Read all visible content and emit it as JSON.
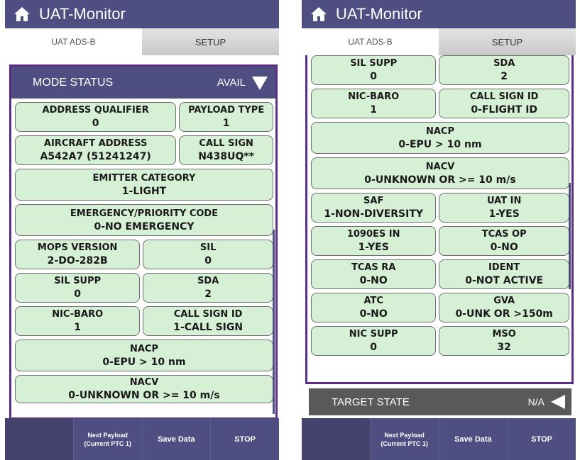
{
  "colors": {
    "appbar": "#4e4e83",
    "panel_border": "#5b2d87",
    "cell_bg": "#d6f0d6",
    "target_bar": "#595959"
  },
  "left": {
    "app_title": "UAT-Monitor",
    "tabs": [
      {
        "label": "UAT ADS-B"
      },
      {
        "label": "SETUP"
      }
    ],
    "section": {
      "label": "MODE STATUS",
      "status": "AVAIL"
    },
    "rows": [
      [
        {
          "k": "ADDRESS QUALIFIER",
          "v": "0"
        },
        {
          "k": "PAYLOAD TYPE",
          "v": "1"
        }
      ],
      [
        {
          "k": "AIRCRAFT ADDRESS",
          "v": "A542A7 (51241247)"
        },
        {
          "k": "CALL SIGN",
          "v": "N438UQ**"
        }
      ],
      [
        {
          "k": "EMITTER CATEGORY",
          "v": "1-LIGHT"
        }
      ],
      [
        {
          "k": "EMERGENCY/PRIORITY CODE",
          "v": "0-NO EMERGENCY"
        }
      ],
      [
        {
          "k": "MOPS VERSION",
          "v": "2-DO-282B"
        },
        {
          "k": "SIL",
          "v": "0"
        }
      ],
      [
        {
          "k": "SIL SUPP",
          "v": "0"
        },
        {
          "k": "SDA",
          "v": "2"
        }
      ],
      [
        {
          "k": "NIC-BARO",
          "v": "1"
        },
        {
          "k": "CALL SIGN ID",
          "v": "1-CALL SIGN"
        }
      ],
      [
        {
          "k": "NACP",
          "v": "0-EPU > 10 nm"
        }
      ],
      [
        {
          "k": "NACV",
          "v": "0-UNKNOWN OR >= 10 m/s"
        }
      ]
    ],
    "bottom": {
      "next_payload": "Next Payload",
      "next_payload_sub": "(Current PTC 1)",
      "save": "Save Data",
      "stop": "STOP"
    }
  },
  "right": {
    "app_title": "UAT-Monitor",
    "tabs": [
      {
        "label": "UAT ADS-B"
      },
      {
        "label": "SETUP"
      }
    ],
    "rows": [
      [
        {
          "k": "SIL SUPP",
          "v": "0"
        },
        {
          "k": "SDA",
          "v": "2"
        }
      ],
      [
        {
          "k": "NIC-BARO",
          "v": "1"
        },
        {
          "k": "CALL SIGN ID",
          "v": "0-FLIGHT ID"
        }
      ],
      [
        {
          "k": "NACP",
          "v": "0-EPU > 10 nm"
        }
      ],
      [
        {
          "k": "NACV",
          "v": "0-UNKNOWN OR >= 10 m/s"
        }
      ],
      [
        {
          "k": "SAF",
          "v": "1-NON-DIVERSITY"
        },
        {
          "k": "UAT IN",
          "v": "1-YES"
        }
      ],
      [
        {
          "k": "1090ES IN",
          "v": "1-YES"
        },
        {
          "k": "TCAS OP",
          "v": "0-NO"
        }
      ],
      [
        {
          "k": "TCAS RA",
          "v": "0-NO"
        },
        {
          "k": "IDENT",
          "v": "0-NOT ACTIVE"
        }
      ],
      [
        {
          "k": "ATC",
          "v": "0-NO"
        },
        {
          "k": "GVA",
          "v": "0-UNK OR >150m"
        }
      ],
      [
        {
          "k": "NIC SUPP",
          "v": "0"
        },
        {
          "k": "MSO",
          "v": "32"
        }
      ]
    ],
    "target": {
      "label": "TARGET STATE",
      "status": "N/A"
    },
    "bottom": {
      "next_payload": "Next Payload",
      "next_payload_sub": "(Current PTC 1)",
      "save": "Save Data",
      "stop": "STOP"
    }
  }
}
